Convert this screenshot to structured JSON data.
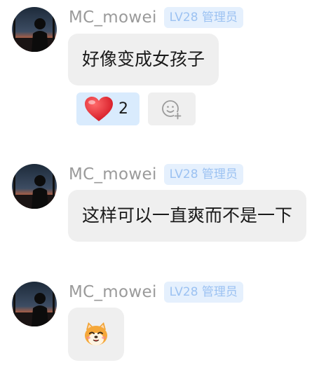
{
  "colors": {
    "username": "#9a9a9a",
    "badge_bg": "#e5f0fd",
    "badge_text": "#9cc2f2",
    "bubble_bg": "#efefef",
    "reaction_bg": "#d9ebfd"
  },
  "messages": [
    {
      "username": "MC_mowei",
      "badge": "LV28 管理员",
      "text": "好像变成女孩子",
      "avatar_icon": "user-avatar-silhouette-sunset",
      "reactions": [
        {
          "icon": "red-heart-icon",
          "count": "2"
        }
      ],
      "add_reaction_icon": "add-emoji-icon"
    },
    {
      "username": "MC_mowei",
      "badge": "LV28 管理员",
      "text": "这样可以一直爽而不是一下",
      "avatar_icon": "user-avatar-silhouette-sunset"
    },
    {
      "username": "MC_mowei",
      "badge": "LV28 管理员",
      "sticker": "shiba-dog-sticker-icon",
      "avatar_icon": "user-avatar-silhouette-sunset"
    }
  ]
}
